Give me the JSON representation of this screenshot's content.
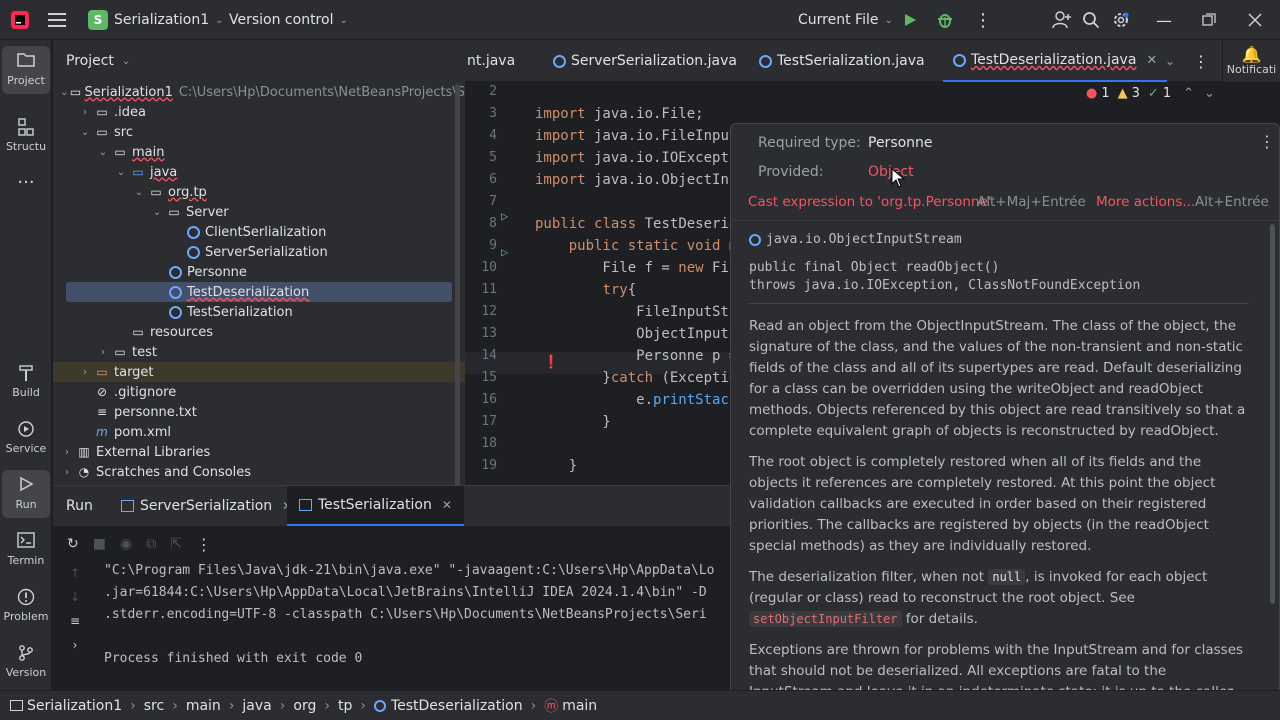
{
  "titlebar": {
    "project_initial": "S",
    "project_name": "Serialization1",
    "vcs": "Version control",
    "run_config": "Current File"
  },
  "left_toolbar": [
    {
      "label": "Project",
      "icon": "folder-icon"
    },
    {
      "label": "Structu",
      "icon": "structure-icon"
    },
    {
      "label": "Build",
      "icon": "hammer-icon"
    },
    {
      "label": "Service",
      "icon": "services-icon"
    },
    {
      "label": "Run",
      "icon": "run-icon"
    },
    {
      "label": "Termin",
      "icon": "terminal-icon"
    },
    {
      "label": "Problem",
      "icon": "problems-icon"
    },
    {
      "label": "Version",
      "icon": "vcs-icon"
    }
  ],
  "project_panel": {
    "title": "Project",
    "root_path": "C:\\Users\\Hp\\Documents\\NetBeansProjects\\S",
    "tree": [
      "Serialization1",
      ".idea",
      "src",
      "main",
      "java",
      "org.tp",
      "Server",
      "ClientSerlialization",
      "ServerSerialization",
      "Personne",
      "TestDeserialization",
      "TestSerialization",
      "resources",
      "test",
      "target",
      ".gitignore",
      "personne.txt",
      "pom.xml",
      "External Libraries",
      "Scratches and Consoles"
    ]
  },
  "editor_tabs": [
    "nt.java",
    "ServerSerialization.java",
    "TestSerialization.java",
    "TestDeserialization.java"
  ],
  "inspection": {
    "errors": "1",
    "warnings": "3",
    "ok": "1"
  },
  "code_lines": [
    {
      "n": "2",
      "t": ""
    },
    {
      "n": "3",
      "t": "import java.io.File;"
    },
    {
      "n": "4",
      "t": "import java.io.FileInput"
    },
    {
      "n": "5",
      "t": "import java.io.IOExcepti"
    },
    {
      "n": "6",
      "t": "import java.io.ObjectInp"
    },
    {
      "n": "7",
      "t": ""
    },
    {
      "n": "8",
      "t": "public class TestDeseria"
    },
    {
      "n": "9",
      "t": "    public static void m"
    },
    {
      "n": "10",
      "t": "        File f = new Fil"
    },
    {
      "n": "11",
      "t": "        try{"
    },
    {
      "n": "12",
      "t": "            FileInputStr"
    },
    {
      "n": "13",
      "t": "            ObjectInputS"
    },
    {
      "n": "14",
      "t": "            Personne p ="
    },
    {
      "n": "15",
      "t": "        }catch (Exceptio"
    },
    {
      "n": "16",
      "t": "            e.printStack"
    },
    {
      "n": "17",
      "t": "        }"
    },
    {
      "n": "18",
      "t": ""
    },
    {
      "n": "19",
      "t": "    }"
    }
  ],
  "run_panel": {
    "title": "Run",
    "tabs": [
      "ServerSerialization",
      "TestSerialization"
    ],
    "console": [
      "\"C:\\Program Files\\Java\\jdk-21\\bin\\java.exe\" \"-javaagent:C:\\Users\\Hp\\AppData\\Lo",
      ".jar=61844:C:\\Users\\Hp\\AppData\\Local\\JetBrains\\IntelliJ IDEA 2024.1.4\\bin\" -D",
      ".stderr.encoding=UTF-8 -classpath C:\\Users\\Hp\\Documents\\NetBeansProjects\\Seri",
      "",
      "Process finished with exit code 0"
    ]
  },
  "popup": {
    "required_label": "Required type:",
    "required_value": "Personne",
    "provided_label": "Provided:",
    "provided_value": "Object",
    "fix_action": "Cast expression to 'org.tp.Personne'",
    "fix_shortcut": "Alt+Maj+Entrée",
    "more_actions": "More actions...",
    "more_shortcut": "Alt+Entrée",
    "doc_class": "java.io.ObjectInputStream",
    "sig1": "public final Object readObject()",
    "sig2": "throws java.io.IOException, ClassNotFoundException",
    "p1": "Read an object from the ObjectInputStream. The class of the object, the signature of the class, and the values of the non-transient and non-static fields of the class and all of its supertypes are read. Default deserializing for a class can be overridden using the writeObject and readObject methods. Objects referenced by this object are read transitively so that a complete equivalent graph of objects is reconstructed by readObject.",
    "p2": "The root object is completely restored when all of its fields and the objects it references are completely restored. At this point the object validation callbacks are executed in order based on their registered priorities. The callbacks are registered by objects (in the readObject special methods) as they are individually restored.",
    "p3a": "The deserialization filter, when not ",
    "p3_code": "null",
    "p3b": ", is invoked for each object (regular or class) read to reconstruct the root object. See ",
    "p3_link": "setObjectInputFilter",
    "p3c": " for details.",
    "p4": "Exceptions are thrown for problems with the InputStream and for classes that should not be deserialized. All exceptions are fatal to the InputStream and leave it in an indeterminate state; it is up to the caller to ignore or recover the stream state."
  },
  "notifications_label": "Notificati",
  "statusbar": [
    "Serialization1",
    "src",
    "main",
    "java",
    "org",
    "tp",
    "TestDeserialization",
    "main"
  ]
}
